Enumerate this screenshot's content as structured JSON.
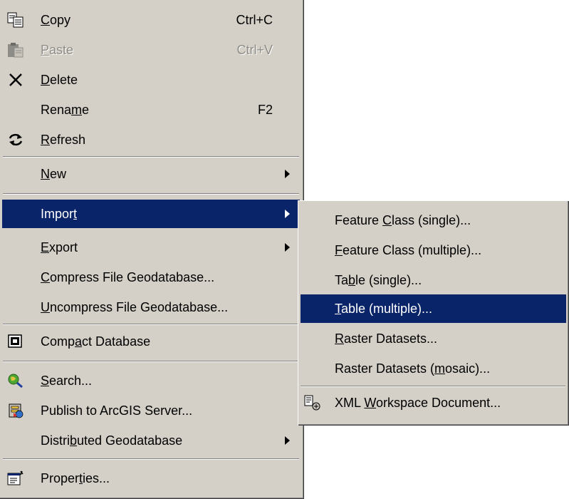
{
  "main_menu": {
    "items": [
      {
        "pre": "",
        "mn": "C",
        "post": "opy",
        "shortcut": "Ctrl+C",
        "icon": "copy-icon"
      },
      {
        "pre": "",
        "mn": "P",
        "post": "aste",
        "shortcut": "Ctrl+V",
        "icon": "paste-icon",
        "disabled": true
      },
      {
        "pre": "",
        "mn": "D",
        "post": "elete",
        "shortcut": "",
        "icon": "delete-icon"
      },
      {
        "pre": "Rena",
        "mn": "m",
        "post": "e",
        "shortcut": "F2",
        "icon": ""
      },
      {
        "pre": "",
        "mn": "R",
        "post": "efresh",
        "shortcut": "",
        "icon": "refresh-icon"
      },
      {
        "pre": "",
        "mn": "N",
        "post": "ew",
        "shortcut": "",
        "icon": "",
        "submenu": true
      },
      {
        "pre": "Impor",
        "mn": "t",
        "post": "",
        "shortcut": "",
        "icon": "",
        "submenu": true,
        "highlighted": true
      },
      {
        "pre": "",
        "mn": "E",
        "post": "xport",
        "shortcut": "",
        "icon": "",
        "submenu": true
      },
      {
        "pre": "",
        "mn": "C",
        "post": "ompress File Geodatabase...",
        "shortcut": "",
        "icon": ""
      },
      {
        "pre": "",
        "mn": "U",
        "post": "ncompress File Geodatabase...",
        "shortcut": "",
        "icon": ""
      },
      {
        "pre": "Comp",
        "mn": "a",
        "post": "ct Database",
        "shortcut": "",
        "icon": "compact-database-icon"
      },
      {
        "pre": "",
        "mn": "S",
        "post": "earch...",
        "shortcut": "",
        "icon": "search-icon"
      },
      {
        "pre": "Publish to ArcGIS Server...",
        "mn": "",
        "post": "",
        "shortcut": "",
        "icon": "publish-server-icon"
      },
      {
        "pre": "Distri",
        "mn": "b",
        "post": "uted Geodatabase",
        "shortcut": "",
        "icon": "",
        "submenu": true
      },
      {
        "pre": "Proper",
        "mn": "t",
        "post": "ies...",
        "shortcut": "",
        "icon": "properties-icon"
      }
    ]
  },
  "import_submenu": {
    "items": [
      {
        "pre": "Feature ",
        "mn": "C",
        "post": "lass (single)...",
        "icon": ""
      },
      {
        "pre": "",
        "mn": "F",
        "post": "eature Class (multiple)...",
        "icon": ""
      },
      {
        "pre": "Ta",
        "mn": "b",
        "post": "le (single)...",
        "icon": ""
      },
      {
        "pre": "",
        "mn": "T",
        "post": "able (multiple)...",
        "icon": "",
        "highlighted": true
      },
      {
        "pre": "",
        "mn": "R",
        "post": "aster Datasets...",
        "icon": ""
      },
      {
        "pre": "Raster Datasets (",
        "mn": "m",
        "post": "osaic)...",
        "icon": ""
      },
      {
        "pre": "XML ",
        "mn": "W",
        "post": "orkspace Document...",
        "icon": "xml-document-icon"
      }
    ]
  },
  "colors": {
    "menu_background": "#d4d0c8",
    "highlight": "#0a246a",
    "disabled_text": "#8e8c86"
  }
}
